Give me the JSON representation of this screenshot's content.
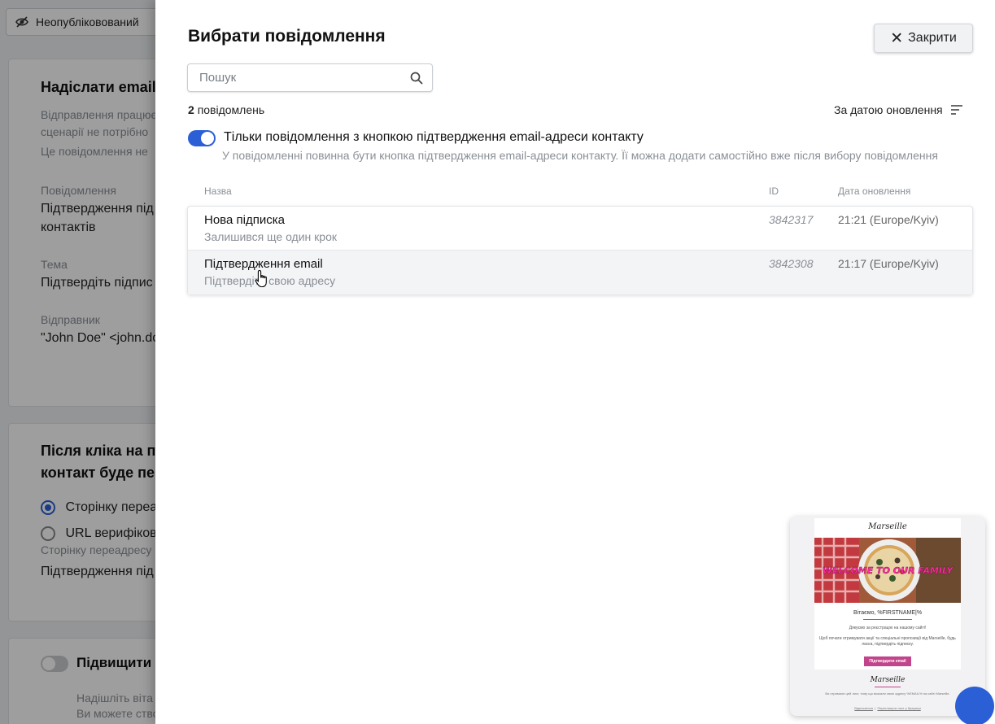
{
  "background": {
    "status": "Неопубліковований",
    "card1": {
      "title": "Надіслати email",
      "desc": "Відправлення працює сценарії не потрібно",
      "note": "Це повідомлення не",
      "message_label": "Повідомлення",
      "message_value": "Підтвердження під контактів",
      "subject_label": "Тема",
      "subject_value": "Підтвердіть підпис",
      "sender_label": "Відправник",
      "sender_value": "\"John Doe\" <john.do"
    },
    "card2": {
      "title": "Після кліка на по контакт буде пер",
      "option1": "Сторінку переа",
      "option2": "URL верифіков",
      "page_label": "Сторінку переадресу",
      "page_value": "Підтвердження під"
    },
    "card3": {
      "title": "Підвищити з",
      "line1": "Надішліть віта",
      "line2": "Ви можете ство"
    }
  },
  "drawer": {
    "title": "Вибрати повідомлення",
    "close_label": "Закрити",
    "search_placeholder": "Пошук",
    "count": "2",
    "count_suffix": "повідомлень",
    "sort_label": "За датою оновлення",
    "toggle_label": "Тільки повідомлення з кнопкою підтвердження email-адреси контакту",
    "toggle_hint": "У повідомленні повинна бути кнопка підтвердження email-адреси контакту. Її можна додати самостійно вже після вибору повідомлення",
    "toggle_on": true,
    "columns": {
      "name": "Назва",
      "id": "ID",
      "date": "Дата оновлення"
    },
    "rows": [
      {
        "name": "Нова підписка",
        "subtitle": "Залишився ще один крок",
        "id": "3842317",
        "date": "21:21 (Europe/Kyiv)"
      },
      {
        "name": "Підтвердження email",
        "subtitle": "Підтвердіть свою адресу",
        "id": "3842308",
        "date": "21:17 (Europe/Kyiv)"
      }
    ]
  },
  "preview": {
    "logo": "Marseille",
    "hero_text": "WELCOME TO OUR FAMILY",
    "greeting": "Вітаємо, %FIRSTNAME|%",
    "line1": "Дякуємо за реєстрацію на нашому сайті!",
    "line2": "Щоб почати отримувати акції та спеціальні пропозиції від Marseille, будь ласка, підтвердіть підписку.",
    "button": "Підтвердити email",
    "footer_logo": "Marseille",
    "footer_text": "Ви отримали цей лист, тому що вказали свою адресу %EMAIL% на сайті Marseille.",
    "footer_link1": "Відписатися",
    "footer_link2": "Переглянути лист у браузері"
  },
  "colors": {
    "accent": "#2b5fd6",
    "brand_pink": "#c2458c"
  }
}
